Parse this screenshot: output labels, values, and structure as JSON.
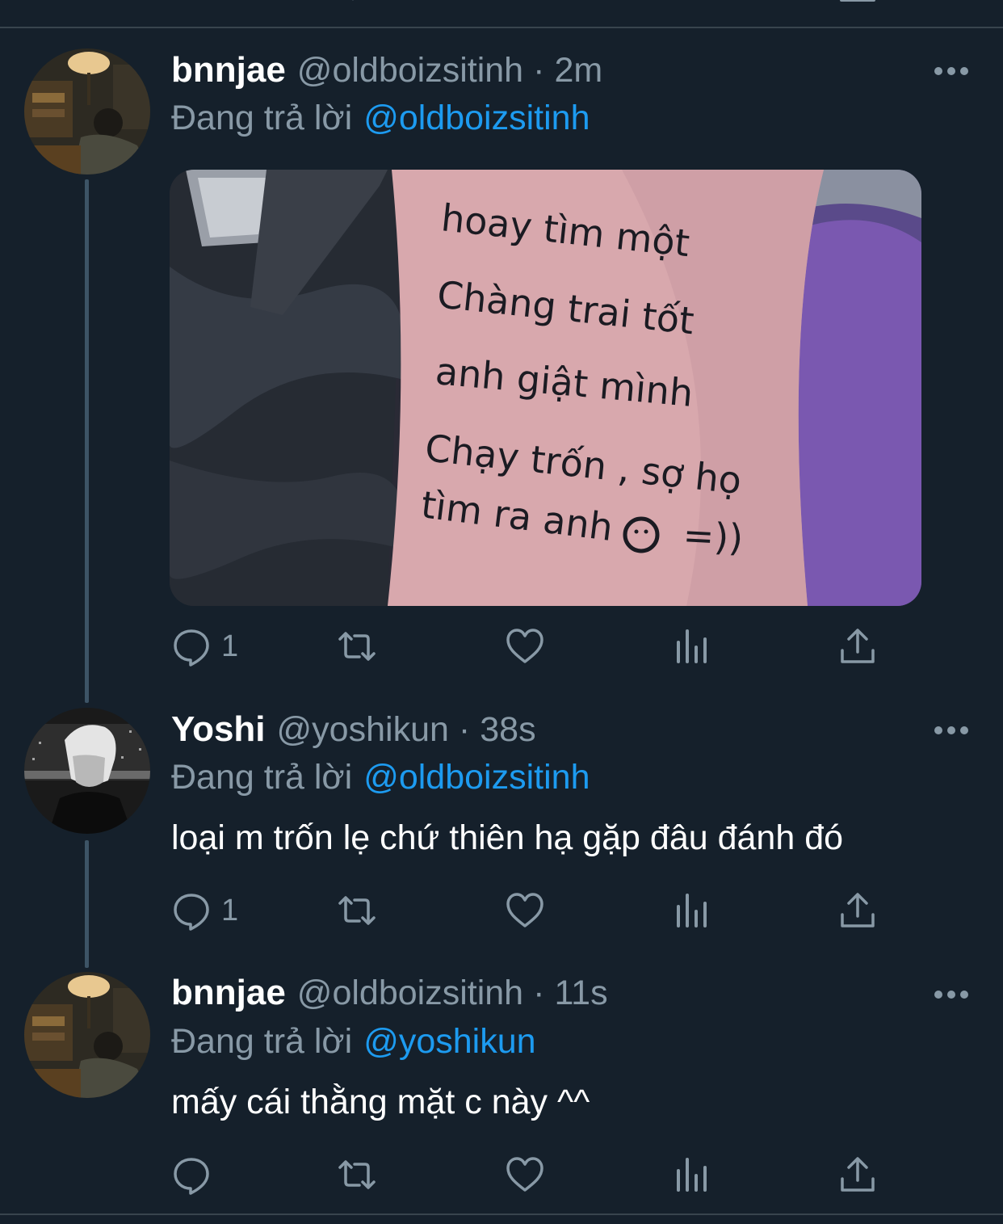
{
  "theme": {
    "background": "#15202b",
    "muted": "#8899a6",
    "link": "#1d9bf0",
    "divider": "#38444d"
  },
  "reply_prefix": "Đang trả lời",
  "tweets": [
    {
      "name": "bnnjae",
      "handle": "@oldboizsitinh",
      "separator": "·",
      "time": "2m",
      "replying_to": "@oldboizsitinh",
      "media": {
        "lines": [
          "hoay tìm một",
          "Chàng trai tốt",
          "anh giật mình",
          "Chạy trốn , sợ họ",
          "tìm ra anh",
          "=))"
        ]
      },
      "actions": {
        "reply_count": "1",
        "retweet_count": "",
        "like_count": ""
      }
    },
    {
      "name": "Yoshi",
      "handle": "@yoshikun",
      "separator": "·",
      "time": "38s",
      "replying_to": "@oldboizsitinh",
      "text": "loại m trốn lẹ chứ thiên hạ gặp đâu đánh đó",
      "actions": {
        "reply_count": "1",
        "retweet_count": "",
        "like_count": ""
      }
    },
    {
      "name": "bnnjae",
      "handle": "@oldboizsitinh",
      "separator": "·",
      "time": "11s",
      "replying_to": "@yoshikun",
      "text": "mấy cái thằng mặt c này ^^",
      "actions": {
        "reply_count": "",
        "retweet_count": "",
        "like_count": ""
      }
    }
  ],
  "icons": [
    "reply-icon",
    "retweet-icon",
    "like-icon",
    "analytics-icon",
    "share-icon",
    "more-icon"
  ]
}
